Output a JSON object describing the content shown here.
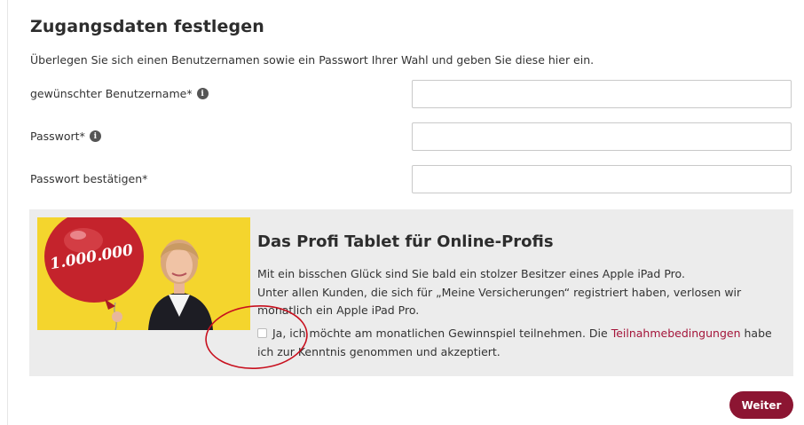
{
  "page": {
    "title": "Zugangsdaten festlegen",
    "intro": "Überlegen Sie sich einen Benutzernamen sowie ein Passwort Ihrer Wahl und geben Sie diese hier ein."
  },
  "form": {
    "username_label": "gewünschter Benutzername*",
    "username_value": "",
    "password_label": "Passwort*",
    "password_value": "",
    "confirm_label": "Passwort bestätigen*",
    "confirm_value": "",
    "info_icon": "info-icon"
  },
  "promo": {
    "image_text": "1.000.000",
    "title": "Das Profi Tablet für Online-Profis",
    "line1": "Mit ein bisschen Glück sind Sie bald ein stolzer Besitzer eines Apple iPad Pro.",
    "line2": "Unter allen Kunden, die sich für „Meine Versicherungen“ registriert haben, verlosen wir",
    "line3": "monatlich ein Apple iPad Pro.",
    "consent_before_link": "Ja, ich möchte am monatlichen Gewinnspiel teilnehmen. Die ",
    "consent_link": "Teilnahmebedingungen",
    "consent_after_link": " habe ich zur Kenntnis genommen und akzeptiert.",
    "checkbox_checked": false
  },
  "actions": {
    "next_label": "Weiter"
  },
  "colors": {
    "accent": "#8c1532",
    "link": "#a4153a",
    "promo_background": "#ececec",
    "annotation": "#c8101e"
  }
}
